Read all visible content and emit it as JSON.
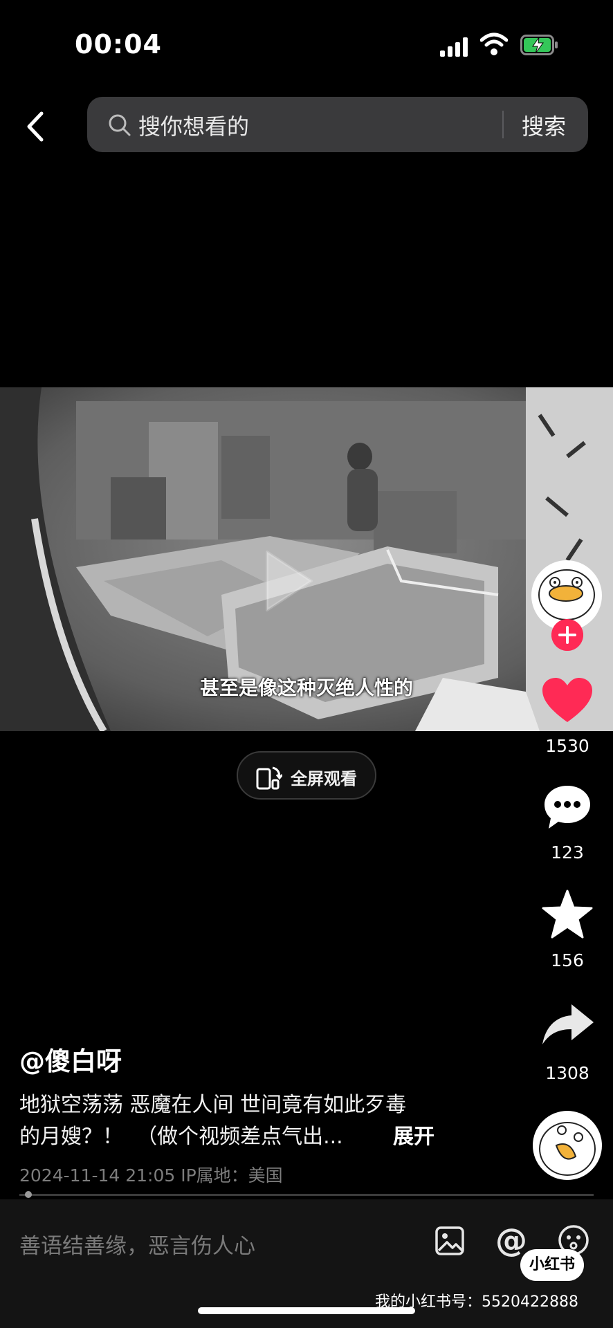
{
  "status_bar": {
    "time": "00:04"
  },
  "search": {
    "placeholder": "搜你想看的",
    "button_label": "搜索"
  },
  "video": {
    "subtitle": "甚至是像这种灭绝人性的"
  },
  "fullscreen": {
    "label": "全屏观看"
  },
  "actions": {
    "likes": "1530",
    "comments": "123",
    "favorites": "156",
    "shares": "1308"
  },
  "post": {
    "author": "@傻白呀",
    "caption_line1": "地狱空荡荡 恶魔在人间 世间竟有如此歹毒",
    "caption_line2": "的月嫂？！  （做个视频差点气出...",
    "expand_label": "展开",
    "meta": "2024-11-14 21:05  IP属地：美国",
    "progress": 0.01
  },
  "comment_bar": {
    "placeholder": "善语结善缘，恶言伤人心",
    "at_symbol": "@"
  },
  "watermark": {
    "badge": "小红书",
    "text": "我的小红书号：5520422888"
  },
  "colors": {
    "accent": "#ff2a55",
    "like": "#ff2a55",
    "background": "#000000"
  }
}
